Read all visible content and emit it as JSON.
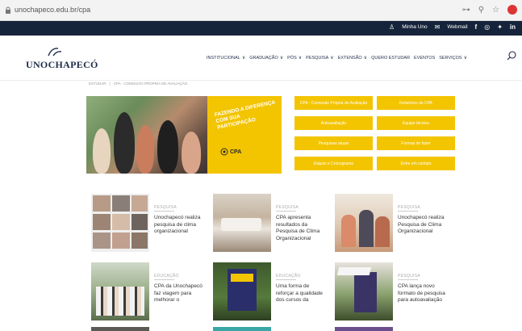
{
  "browser": {
    "url": "unochapeco.edu.br/cpa"
  },
  "topbar": {
    "items": [
      {
        "label": "Minha Uno",
        "icon": "user-icon"
      },
      {
        "label": "Webmail",
        "icon": "mail-icon"
      }
    ],
    "social": [
      "facebook-icon",
      "instagram-icon",
      "twitter-icon",
      "linkedin-icon"
    ]
  },
  "logo": {
    "text": "UNOCHAPECÓ"
  },
  "nav": {
    "items": [
      {
        "label": "INSTITUCIONAL",
        "chev": "∨"
      },
      {
        "label": "GRADUAÇÃO",
        "chev": "∨"
      },
      {
        "label": "PÓS",
        "chev": "∨"
      },
      {
        "label": "PESQUISA",
        "chev": "∨"
      },
      {
        "label": "EXTENSÃO",
        "chev": "∨"
      },
      {
        "label": "QUERO ESTUDAR",
        "chev": ""
      },
      {
        "label": "EVENTOS",
        "chev": ""
      },
      {
        "label": "SERVIÇOS",
        "chev": "∨"
      }
    ]
  },
  "breadcrumb": {
    "items": [
      "ESTUDAR",
      "|",
      "CPA - COMISSÃO PRÓPRIA DE AVALIAÇÃO"
    ]
  },
  "banner": {
    "slogan": "FAZENDO A DIFERENÇA COM SUA PARTICIPAÇÃO",
    "brand": "CPA",
    "colors": {
      "yellow": "#f3c400"
    }
  },
  "buttons": [
    "CPA - Comissão Própria de Avaliação",
    "Relatórios da CPA",
    "Autoavaliação",
    "Equipe técnica",
    "Pesquisas atuais",
    "Formas de fazer",
    "Etapas e Cronograma",
    "Entre em contato"
  ],
  "cards": [
    {
      "tag": "PESQUISA",
      "title": "Unochapecó realiza pesquisa de clima organizacional"
    },
    {
      "tag": "PESQUISA",
      "title": "CPA apresenta resultados da Pesquisa de Clima Organizacional"
    },
    {
      "tag": "PESQUISA",
      "title": "Unochapecó realiza Pesquisa de Clima Organizacional"
    },
    {
      "tag": "EDUCAÇÃO",
      "title": "CPA da Unochapecó faz viagem para melhorar o"
    },
    {
      "tag": "EDUCAÇÃO",
      "title": "Uma forma de reforçar a qualidade dos cursos da"
    },
    {
      "tag": "PESQUISA",
      "title": "CPA lança novo formato de pesquisa para autoavaliação"
    }
  ]
}
